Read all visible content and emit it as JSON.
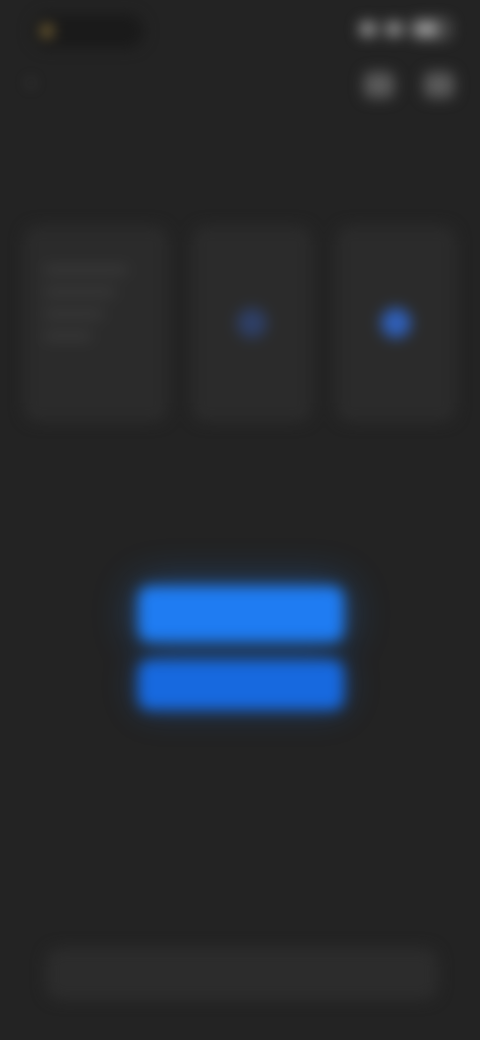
{
  "status_bar": {
    "time": "",
    "accent_color": "#c9a24a"
  },
  "nav": {
    "back_label": "",
    "right_icons": [
      "share-icon",
      "more-icon"
    ]
  },
  "page": {
    "title": ""
  },
  "cards": [
    {
      "heading": "",
      "label": "",
      "icon": ""
    },
    {
      "heading": "",
      "label": "",
      "icon": "option-icon"
    },
    {
      "heading": "",
      "label": "",
      "icon": "option-icon"
    }
  ],
  "actions": {
    "top_left_link": "",
    "top_right_link": "",
    "primary_label": "",
    "secondary_label": "",
    "primary_color": "#1f7cf2",
    "secondary_color": "#1769df"
  },
  "bottom_bar": {
    "label": ""
  },
  "colors": {
    "background": "#232323",
    "card_background": "#2b2b2b"
  }
}
